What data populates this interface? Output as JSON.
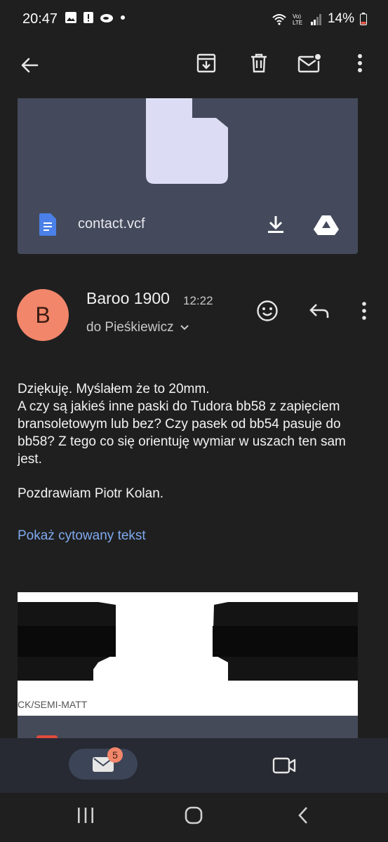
{
  "status_bar": {
    "time": "20:47",
    "battery": "14%",
    "icons": [
      "image-icon",
      "alert-icon",
      "cloud-icon",
      "dot-icon",
      "wifi-icon",
      "volte-icon",
      "signal-icon",
      "battery-icon"
    ]
  },
  "app_bar": {
    "icons": [
      "back-arrow-icon",
      "archive-icon",
      "delete-icon",
      "mark-unread-icon",
      "more-vert-icon"
    ]
  },
  "attachment": {
    "file_name": "contact.vcf",
    "icons": [
      "file-preview-icon",
      "doc-icon",
      "download-icon",
      "drive-icon"
    ]
  },
  "message": {
    "avatar_letter": "B",
    "sender": "Baroo 1900",
    "time": "12:22",
    "recipient": "do Pieśkiewicz",
    "body_lines": [
      "Dziękuję. Myślałem że to 20mm.",
      "A czy są jakieś inne paski do Tudora bb58 z zapięciem bransoletowym lub bez? Czy pasek od bb54 pasuje do bb58? Z tego co się orientuję wymiar w uszach ten sam jest."
    ],
    "signature": "Pozdrawiam Piotr Kolan.",
    "show_quoted": "Pokaż cytowany tekst"
  },
  "image_attachment": {
    "caption": "CK/SEMI-MATT"
  },
  "bottom_nav": {
    "mail_badge": "5"
  },
  "colors": {
    "background": "#1f1f1f",
    "card": "#444a5b",
    "accent_link": "#7fa9ef",
    "avatar": "#f2866a"
  }
}
